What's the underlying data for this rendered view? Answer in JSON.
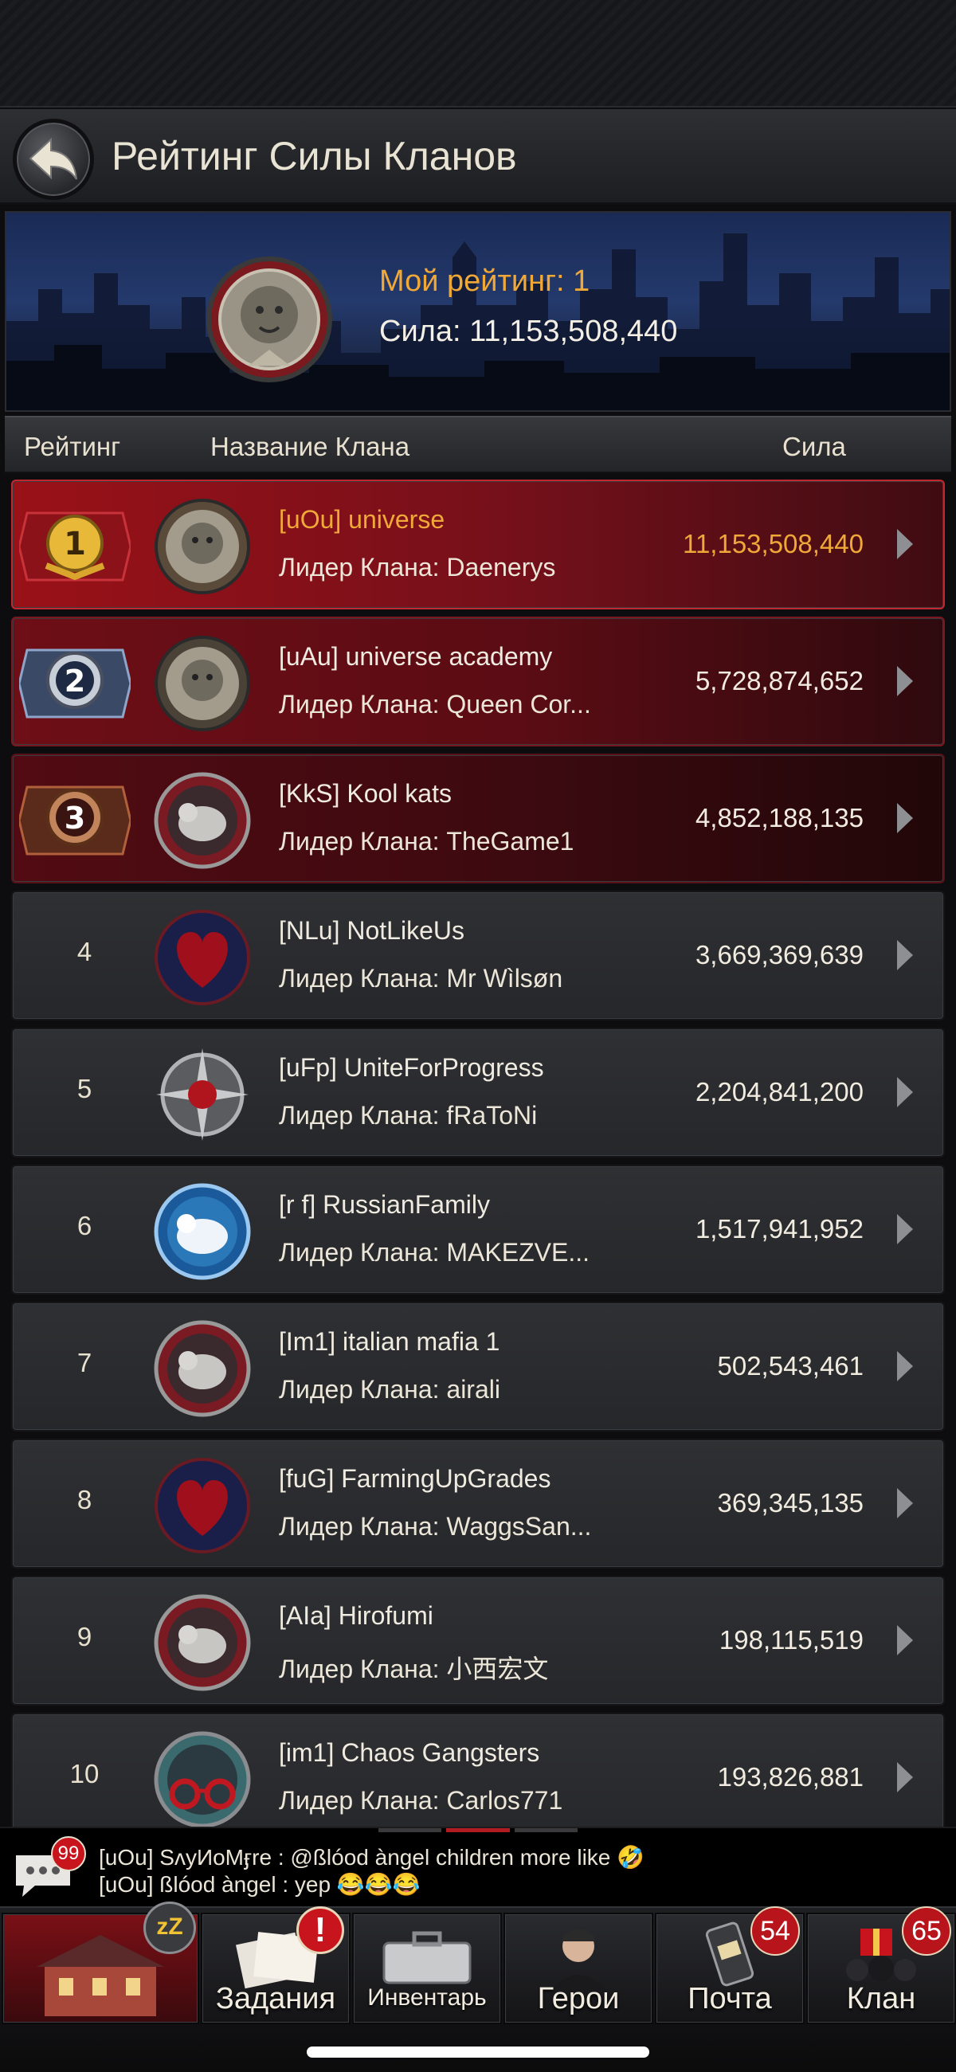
{
  "header": {
    "title": "Рейтинг Силы Кланов"
  },
  "banner": {
    "my_rank": "Мой рейтинг: 1",
    "my_power": "Сила: 11,153,508,440"
  },
  "columns": {
    "rank": "Рейтинг",
    "name": "Название Клана",
    "power": "Сила"
  },
  "rows": [
    {
      "rank": "1",
      "name": "[uOu] universe",
      "leader": "Лидер Клана: Daenerys",
      "power": "11,153,508,440",
      "emblem": "lion-emblem"
    },
    {
      "rank": "2",
      "name": "[uAu] universe academy",
      "leader": "Лидер Клана: Queen Cor...",
      "power": "5,728,874,652",
      "emblem": "lion-emblem"
    },
    {
      "rank": "3",
      "name": "[KkS] Kool kats",
      "leader": "Лидер Клана: TheGame1",
      "power": "4,852,188,135",
      "emblem": "bear-emblem"
    },
    {
      "rank": "4",
      "name": "[NLu] NotLikeUs",
      "leader": "Лидер Клана: Mr Wìlsøn",
      "power": "3,669,369,639",
      "emblem": "heart-emblem"
    },
    {
      "rank": "5",
      "name": "[uFp] UniteForProgress",
      "leader": "Лидер Клана: fRaToNi",
      "power": "2,204,841,200",
      "emblem": "rose-cross-emblem"
    },
    {
      "rank": "6",
      "name": "[r f] RussianFamily",
      "leader": "Лидер Клана: MAKEZVE...",
      "power": "1,517,941,952",
      "emblem": "ice-bear-emblem"
    },
    {
      "rank": "7",
      "name": "[Im1] italian mafia 1",
      "leader": "Лидер Клана: airali",
      "power": "502,543,461",
      "emblem": "bear-emblem"
    },
    {
      "rank": "8",
      "name": "[fuG] FarmingUpGrades",
      "leader": "Лидер Клана: WaggsSan...",
      "power": "369,345,135",
      "emblem": "heart-emblem"
    },
    {
      "rank": "9",
      "name": "[AIa] Hirofumi",
      "leader": "Лидер Клана: 小西宏文",
      "power": "198,115,519",
      "emblem": "bear-emblem"
    },
    {
      "rank": "10",
      "name": "[im1] Chaos Gangsters",
      "leader": "Лидер Клана: Carlos771",
      "power": "193,826,881",
      "emblem": "handcuffs-emblem"
    }
  ],
  "chat": {
    "badge": "99",
    "line1": "[uOu] SʌуИоМӻre : @ßlóod àngel children more like 🤣",
    "line2": "[uOu] ßlóod àngel : yep 😂😂😂"
  },
  "nav": {
    "home_badge": "zZ",
    "tasks_label": "Задания",
    "tasks_badge": "!",
    "inventory_label": "Инвентарь",
    "heroes_label": "Герои",
    "mail_label": "Почта",
    "mail_badge": "54",
    "clan_label": "Клан",
    "clan_badge": "65"
  },
  "colors": {
    "accent_orange": "#f0a838",
    "top_row_red": "#9a1118",
    "badge_red": "#c8141c"
  }
}
